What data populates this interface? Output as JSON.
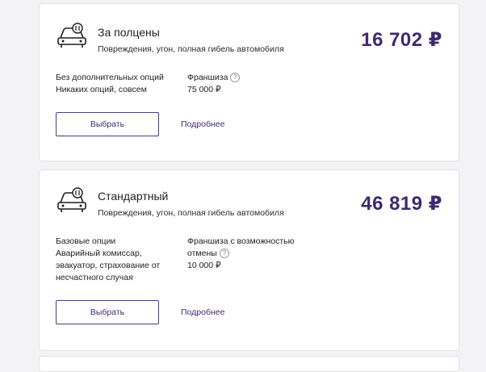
{
  "plans": [
    {
      "title": "За полцены",
      "subtitle": "Повреждения, угон, полная гибель автомобиля",
      "price": "16 702 ₽",
      "options_heading": "Без дополнительных опций",
      "options_text": "Никаких опций, совсем",
      "franchise_heading": "Франшиза",
      "franchise_value": "75 000 ₽",
      "select_label": "Выбрать",
      "details_label": "Подробнее",
      "icon": "car-icon"
    },
    {
      "title": "Стандартный",
      "subtitle": "Повреждения, угон, полная гибель автомобиля",
      "price": "46 819 ₽",
      "options_heading": "Базовые опции",
      "options_text": "Аварийный комиссар, эвакуатор, страхование от несчастного случая",
      "franchise_heading": "Франшиза с возможностью отмены",
      "franchise_value": "10 000 ₽",
      "select_label": "Выбрать",
      "details_label": "Подробнее",
      "icon": "car-icon"
    }
  ],
  "colors": {
    "accent": "#3f2a6e",
    "border": "#e2e2e7",
    "background": "#f3f3f5"
  },
  "help_icon": "question-circle-icon"
}
